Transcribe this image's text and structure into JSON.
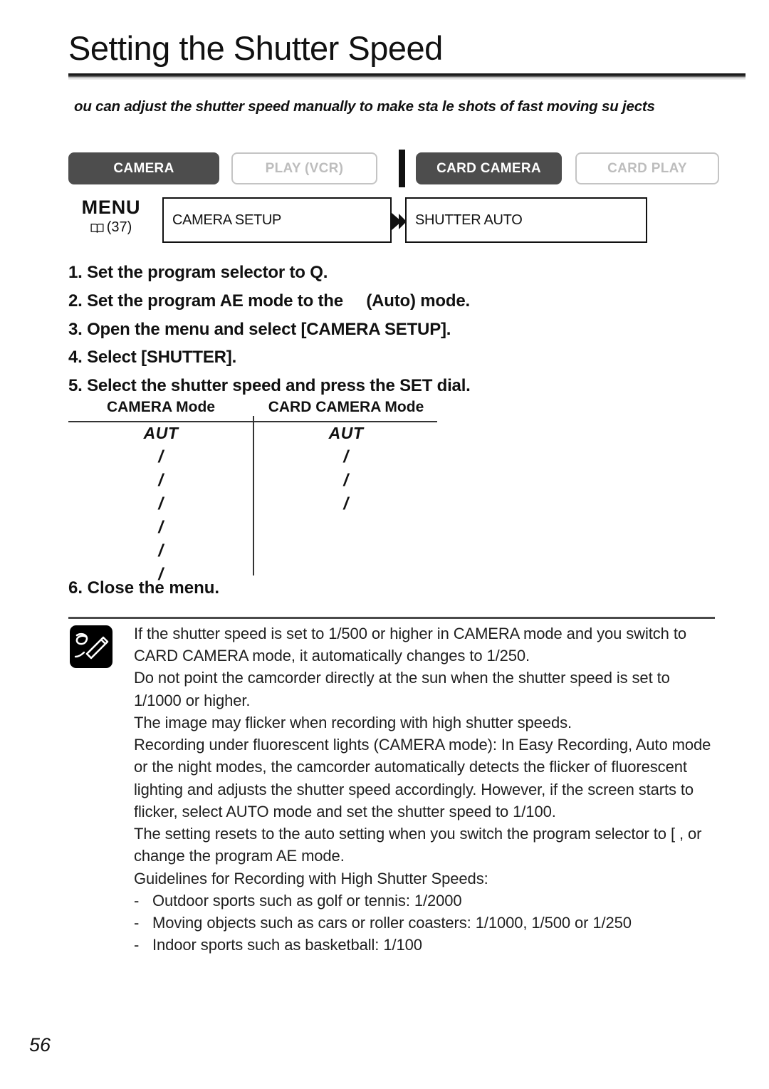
{
  "page": {
    "title": "Setting the Shutter Speed",
    "number": "56"
  },
  "intro": "ou can adjust the shutter speed manually to make sta le shots of fast moving su jects",
  "modes": {
    "buttons": [
      {
        "label": "CAMERA",
        "state": "active"
      },
      {
        "label": "PLAY (VCR)",
        "state": "inactive"
      },
      {
        "label": "CARD CAMERA",
        "state": "active"
      },
      {
        "label": "CARD PLAY",
        "state": "inactive"
      }
    ],
    "active_color": "#4d4d4d",
    "inactive_border_color": "#c4c4c4",
    "inactive_text_color": "#bdbdbd"
  },
  "menu": {
    "label": "MENU",
    "book_icon": "open-book-icon",
    "reference_page": "37",
    "box_1": "CAMERA SETUP",
    "arrow_icon": "double-chevron-right-icon",
    "box_2": "SHUTTER    AUTO"
  },
  "steps": [
    "1. Set the program selector to Q.",
    "2. Set the program AE mode to the ",
    "3. Open the menu and select [CAMERA SETUP].",
    "4. Select [SHUTTER].",
    "5. Select the shutter speed and press the SET dial."
  ],
  "step2_suffix": "(Auto) mode.",
  "step6": "6. Close the menu.",
  "speed_table": {
    "headers": [
      "CAMERA Mode",
      "CARD CAMERA Mode"
    ],
    "camera_mode_values": [
      "AUT",
      "/",
      "/",
      "/",
      "/",
      "/",
      "/"
    ],
    "card_camera_mode_values": [
      "AUT",
      "/",
      "/",
      "/"
    ]
  },
  "notes": {
    "icon": "pencil-note-icon",
    "paragraphs": [
      "If the shutter speed is set to 1/500 or higher in CAMERA mode and you switch to CARD CAMERA mode, it automatically changes to 1/250.",
      "Do not point the camcorder directly at the sun when the shutter speed is set to 1/1000 or higher.",
      "The image may flicker when recording with high shutter speeds.",
      "Recording under fluorescent lights (CAMERA mode): In Easy Recording, Auto mode or the night modes, the camcorder automatically detects the flicker of fluorescent lighting and adjusts the shutter speed accordingly. However, if the screen starts to flicker, select AUTO mode and set the shutter speed to 1/100.",
      "The setting resets to the auto setting when you switch the program selector to [  , or change the program AE mode.",
      "Guidelines for Recording with High Shutter Speeds:"
    ],
    "guidelines": [
      {
        "dash": "-",
        "text": "Outdoor sports such as golf or tennis: 1/2000"
      },
      {
        "dash": "-",
        "text": "Moving objects such as cars or roller coasters: 1/1000, 1/500 or 1/250"
      },
      {
        "dash": "-",
        "text": "Indoor sports such as basketball: 1/100"
      }
    ]
  }
}
